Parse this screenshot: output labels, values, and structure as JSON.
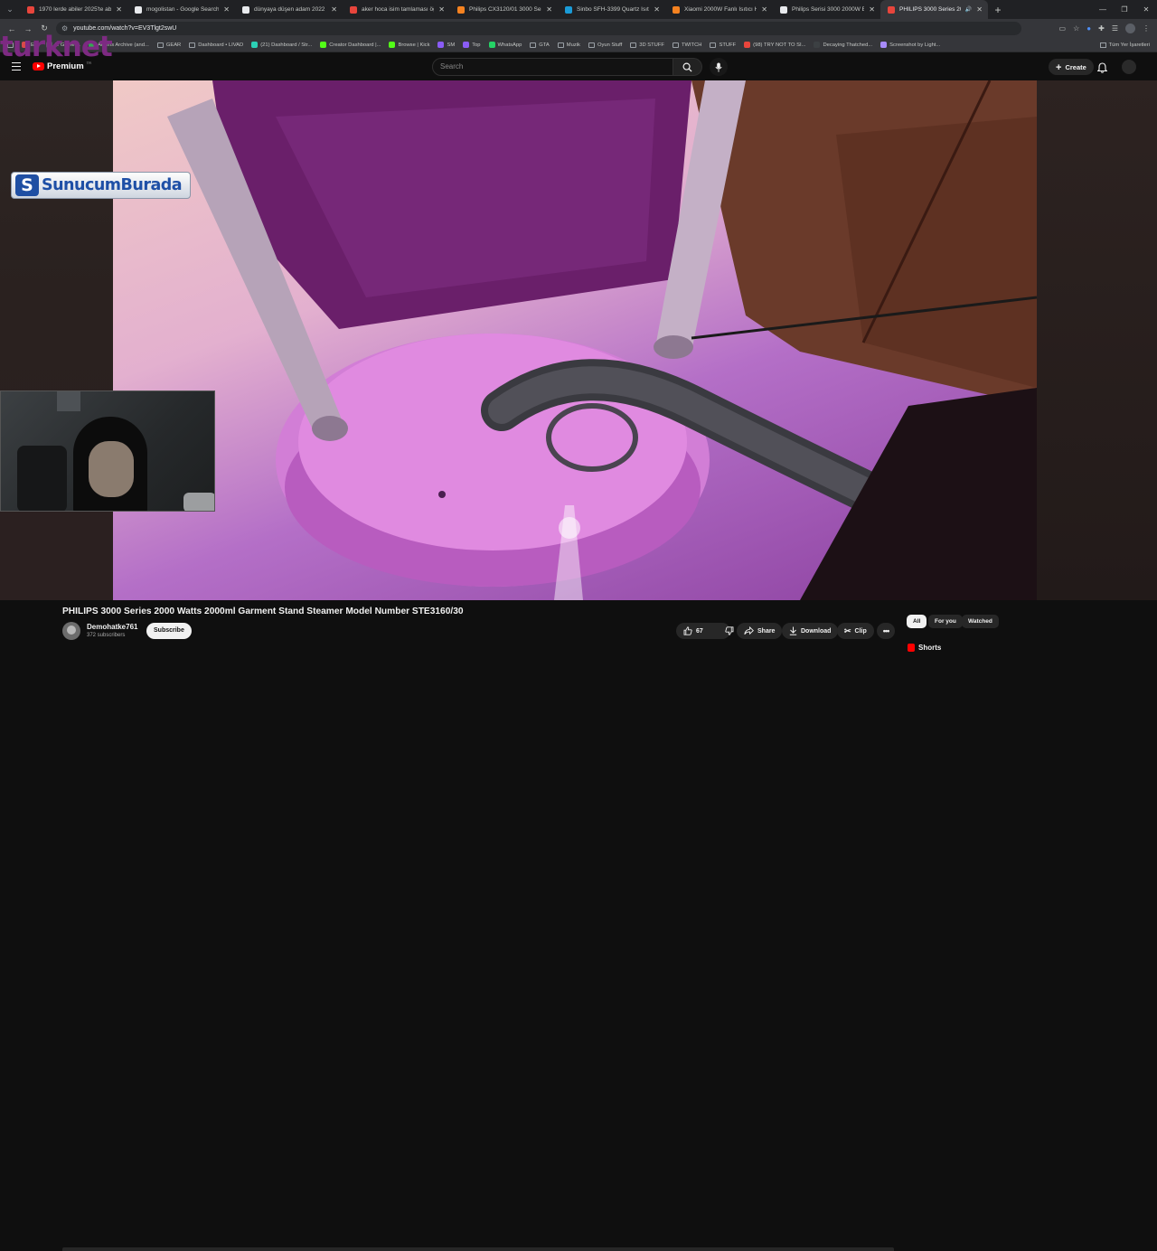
{
  "browser": {
    "tabs": [
      {
        "title": "1970 lerde abiler 2025'te abiler",
        "color": "#e8453c"
      },
      {
        "title": "mogolistan - Google Search",
        "color": "#e8eaed"
      },
      {
        "title": "dünyaya düşen adam 2022 - G",
        "color": "#e8eaed"
      },
      {
        "title": "aker hoca isim tamlaması öğreti",
        "color": "#e8453c"
      },
      {
        "title": "Philips CX3120/01 3000 Serisi",
        "color": "#f58220"
      },
      {
        "title": "Sinbo SFH-3399 Quartz Isıtıcı",
        "color": "#1a9bd7"
      },
      {
        "title": "Xiaomi 2000W Fanlı Isıtıcı Hızlı",
        "color": "#f58220"
      },
      {
        "title": "Philips Serisi 3000 2000W Ener",
        "color": "#e8eaed"
      },
      {
        "title": "PHILIPS 3000 Series 2000",
        "color": "#e8453c",
        "active": true
      }
    ],
    "url": "youtube.com/watch?v=EV3Tlgt2swU",
    "bookmarks": [
      {
        "label": "",
        "kind": "folder"
      },
      {
        "label": "EA",
        "kind": "icon",
        "color": "#d94a4a"
      },
      {
        "label": "ie Game ...",
        "kind": "icon",
        "color": "#5b5f66"
      },
      {
        "label": "Adams Archive (and...",
        "kind": "icon",
        "color": "#34a853"
      },
      {
        "label": "GEAR",
        "kind": "folder"
      },
      {
        "label": "Dashboard • LIVAD",
        "kind": "folder"
      },
      {
        "label": "(21) Dashboard / Str...",
        "kind": "icon",
        "color": "#2bd0b5"
      },
      {
        "label": "Creator Dashboard |...",
        "kind": "icon",
        "color": "#53fc18"
      },
      {
        "label": "Browse | Kick",
        "kind": "icon",
        "color": "#53fc18"
      },
      {
        "label": "SM",
        "kind": "icon",
        "color": "#8a5cf6"
      },
      {
        "label": "Top",
        "kind": "icon",
        "color": "#8a5cf6"
      },
      {
        "label": "WhatsApp",
        "kind": "icon",
        "color": "#25d366"
      },
      {
        "label": "GTA",
        "kind": "folder"
      },
      {
        "label": "Muzik",
        "kind": "folder"
      },
      {
        "label": "Oyun Stuff",
        "kind": "folder"
      },
      {
        "label": "3D STUFF",
        "kind": "folder"
      },
      {
        "label": "TWITCH",
        "kind": "folder"
      },
      {
        "label": "STUFF",
        "kind": "folder"
      },
      {
        "label": "(98) TRY NOT TO SI...",
        "kind": "icon",
        "color": "#e8453c"
      },
      {
        "label": "Decaying Thatched...",
        "kind": "icon",
        "color": "#3c4043"
      },
      {
        "label": "Screenshot by Light...",
        "kind": "icon",
        "color": "#a78bfa"
      }
    ],
    "all_bookmarks": "Tüm Yer İşaretleri"
  },
  "youtube": {
    "brand": "Premium",
    "overlay_watermark": "turknet",
    "search_placeholder": "Search",
    "create_label": "Create"
  },
  "video": {
    "overlay_badge": "SunucumBurada",
    "title": "PHILIPS 3000 Series 2000 Watts 2000ml Garment Stand Steamer Model Number STE3160/30",
    "channel": "Demohatke761",
    "subscribers": "372 subscribers",
    "subscribe_label": "Subscribe",
    "likes": "67",
    "share_label": "Share",
    "download_label": "Download",
    "clip_label": "Clip"
  },
  "sidebar": {
    "chips": [
      "All",
      "For you",
      "Watched"
    ],
    "shorts_label": "Shorts"
  }
}
